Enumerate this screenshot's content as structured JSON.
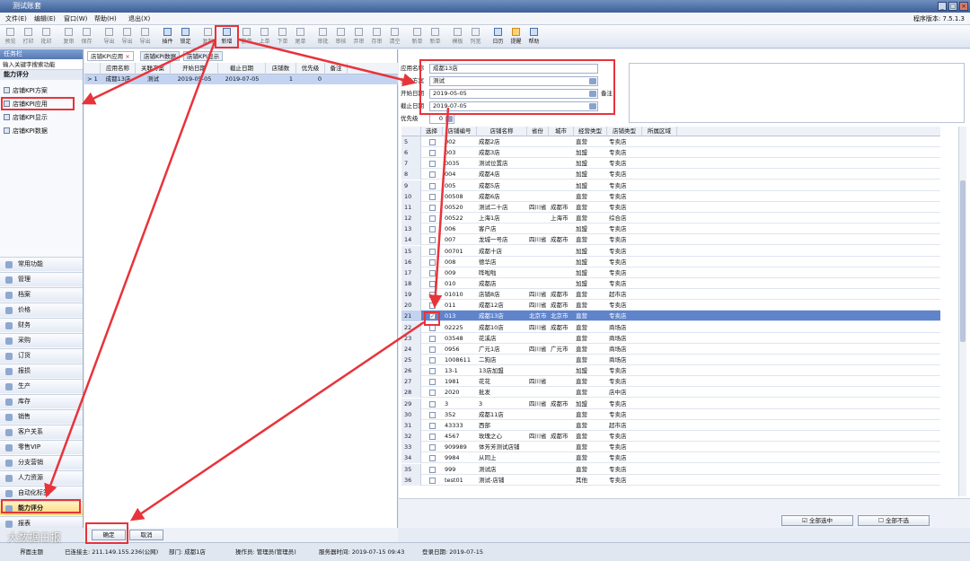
{
  "window": {
    "title": "测试账套",
    "version": "程序版本: 7.5.1.3"
  },
  "menu": [
    "文件(E)",
    "编辑(E)",
    "窗口(W)",
    "帮助(H)",
    "退出(X)"
  ],
  "toolbar": [
    "预览",
    "打印",
    "批印",
    "复审",
    "保存",
    "导出",
    "导出",
    "导出",
    "插件",
    "锁定",
    "复制",
    "新增",
    "删单",
    "上单",
    "下单",
    "尾单",
    "审批",
    "审核",
    "弃审",
    "存审",
    "清空",
    "新单",
    "新单",
    "模板",
    "列宽",
    "日历",
    "提醒",
    "帮助"
  ],
  "left": {
    "header": "任务栏",
    "search": "输入关键字搜索功能",
    "section": "能力评分",
    "tree": [
      "店铺KPI方案",
      "店铺KPI应用",
      "店铺KPI显示",
      "店铺KPI数据"
    ],
    "nav": [
      "常用功能",
      "管理",
      "档案",
      "价格",
      "财务",
      "采购",
      "订货",
      "报损",
      "生产",
      "库存",
      "销售",
      "客户关系",
      "零售VIP",
      "分支营销",
      "人力资源",
      "自动化标签",
      "能力评分",
      "报表"
    ],
    "nav_selected": "能力评分"
  },
  "center": {
    "tabs": [
      "店铺KPI应用",
      "店铺KPI数据",
      "店铺KPI显示"
    ],
    "columns": [
      "应用名称",
      "关联方案",
      "开始日期",
      "截止日期",
      "店铺数",
      "优先级",
      "备注"
    ],
    "row": {
      "marker": "> 1",
      "name": "成都13店",
      "scheme": "测试",
      "start": "2019-05-05",
      "end": "2019-07-05",
      "shops": "1",
      "priority": "0",
      "remark": ""
    },
    "ok": "确定",
    "cancel": "取消"
  },
  "form": {
    "name_label": "应用名称",
    "name_value": "成都13店",
    "scheme_label": "关联方案",
    "scheme_value": "测试",
    "start_label": "开始日期",
    "start_value": "2019-05-05",
    "end_label": "截止日期",
    "end_value": "2019-07-05",
    "priority_label": "优先级",
    "priority_value": "0",
    "remark_label": "备注"
  },
  "grid": {
    "columns": [
      "选择",
      "店铺编号",
      "店铺名称",
      "省份",
      "城市",
      "经营类型",
      "店铺类型",
      "所属区域"
    ],
    "rows": [
      {
        "n": "5",
        "code": "002",
        "name": "成都2店",
        "prov": "",
        "city": "",
        "biz": "直营",
        "type": "专卖店"
      },
      {
        "n": "6",
        "code": "003",
        "name": "成都3店",
        "prov": "",
        "city": "",
        "biz": "加盟",
        "type": "专卖店"
      },
      {
        "n": "7",
        "code": "0035",
        "name": "测试位置店",
        "prov": "",
        "city": "",
        "biz": "加盟",
        "type": "专卖店"
      },
      {
        "n": "8",
        "code": "004",
        "name": "成都4店",
        "prov": "",
        "city": "",
        "biz": "加盟",
        "type": "专卖店"
      },
      {
        "n": "9",
        "code": "005",
        "name": "成都5店",
        "prov": "",
        "city": "",
        "biz": "加盟",
        "type": "专卖店"
      },
      {
        "n": "10",
        "code": "00508",
        "name": "成都6店",
        "prov": "",
        "city": "",
        "biz": "直营",
        "type": "专卖店"
      },
      {
        "n": "11",
        "code": "00520",
        "name": "测试二十店",
        "prov": "四川省",
        "city": "成都市",
        "biz": "直营",
        "type": "专卖店"
      },
      {
        "n": "12",
        "code": "00522",
        "name": "上海1店",
        "prov": "",
        "city": "上海市",
        "biz": "直营",
        "type": "综合店"
      },
      {
        "n": "13",
        "code": "006",
        "name": "客户店",
        "prov": "",
        "city": "",
        "biz": "加盟",
        "type": "专卖店"
      },
      {
        "n": "14",
        "code": "007",
        "name": "龙城一号店",
        "prov": "四川省",
        "city": "成都市",
        "biz": "直营",
        "type": "专卖店"
      },
      {
        "n": "15",
        "code": "00701",
        "name": "成都十店",
        "prov": "",
        "city": "",
        "biz": "加盟",
        "type": "专卖店"
      },
      {
        "n": "16",
        "code": "008",
        "name": "德华店",
        "prov": "",
        "city": "",
        "biz": "加盟",
        "type": "专卖店"
      },
      {
        "n": "17",
        "code": "009",
        "name": "哗啦啦",
        "prov": "",
        "city": "",
        "biz": "加盟",
        "type": "专卖店"
      },
      {
        "n": "18",
        "code": "010",
        "name": "成都店",
        "prov": "",
        "city": "",
        "biz": "加盟",
        "type": "专卖店"
      },
      {
        "n": "19",
        "code": "01010",
        "name": "店铺8店",
        "prov": "四川省",
        "city": "成都市",
        "biz": "直营",
        "type": "超市店"
      },
      {
        "n": "20",
        "code": "011",
        "name": "成都12店",
        "prov": "四川省",
        "city": "成都市",
        "biz": "直营",
        "type": "专卖店"
      },
      {
        "n": "21",
        "code": "013",
        "name": "成都13店",
        "prov": "北京市",
        "city": "北京市",
        "biz": "直营",
        "type": "专卖店",
        "checked": true
      },
      {
        "n": "22",
        "code": "02225",
        "name": "成都10店",
        "prov": "四川省",
        "city": "成都市",
        "biz": "直营",
        "type": "商场店"
      },
      {
        "n": "23",
        "code": "03548",
        "name": "花溪店",
        "prov": "",
        "city": "",
        "biz": "直营",
        "type": "商场店"
      },
      {
        "n": "24",
        "code": "0956",
        "name": "广元1店",
        "prov": "四川省",
        "city": "广元市",
        "biz": "直营",
        "type": "商场店"
      },
      {
        "n": "25",
        "code": "1008611",
        "name": "二狗店",
        "prov": "",
        "city": "",
        "biz": "直营",
        "type": "商场店"
      },
      {
        "n": "26",
        "code": "13-1",
        "name": "13店加盟",
        "prov": "",
        "city": "",
        "biz": "加盟",
        "type": "专卖店"
      },
      {
        "n": "27",
        "code": "1981",
        "name": "花花",
        "prov": "四川省",
        "city": "",
        "biz": "直营",
        "type": "专卖店"
      },
      {
        "n": "28",
        "code": "2020",
        "name": "批发",
        "prov": "",
        "city": "",
        "biz": "直营",
        "type": "店中店"
      },
      {
        "n": "29",
        "code": "3",
        "name": "3",
        "prov": "四川省",
        "city": "成都市",
        "biz": "加盟",
        "type": "专卖店"
      },
      {
        "n": "30",
        "code": "352",
        "name": "成都11店",
        "prov": "",
        "city": "",
        "biz": "直营",
        "type": "专卖店"
      },
      {
        "n": "31",
        "code": "43333",
        "name": "西部",
        "prov": "",
        "city": "",
        "biz": "直营",
        "type": "超市店"
      },
      {
        "n": "32",
        "code": "4567",
        "name": "玫瑰之心",
        "prov": "四川省",
        "city": "成都市",
        "biz": "直营",
        "type": "专卖店"
      },
      {
        "n": "33",
        "code": "909989",
        "name": "体芳芳测试店铺",
        "prov": "",
        "city": "",
        "biz": "直营",
        "type": "专卖店"
      },
      {
        "n": "34",
        "code": "9984",
        "name": "从同上",
        "prov": "",
        "city": "",
        "biz": "直营",
        "type": "专卖店"
      },
      {
        "n": "35",
        "code": "999",
        "name": "测试店",
        "prov": "",
        "city": "",
        "biz": "直营",
        "type": "专卖店"
      },
      {
        "n": "36",
        "code": "test01",
        "name": "测试-店铺",
        "prov": "",
        "city": "",
        "biz": "其他",
        "type": "专卖店"
      }
    ],
    "select_all": "全部选中",
    "deselect_all": "全部不选"
  },
  "status": [
    "界面主题",
    "已连接主: 211.149.155.236(公网)",
    "部门: 成都1店",
    "操作员: 管理员(管理员)",
    "服务器时间: 2019-07-15 09:43",
    "登录日期: 2019-07-15"
  ],
  "watermark": "大数据日报",
  "colors": {
    "annotation": "#e8333a",
    "selection": "#5f84cc",
    "header": "#5678b4"
  }
}
